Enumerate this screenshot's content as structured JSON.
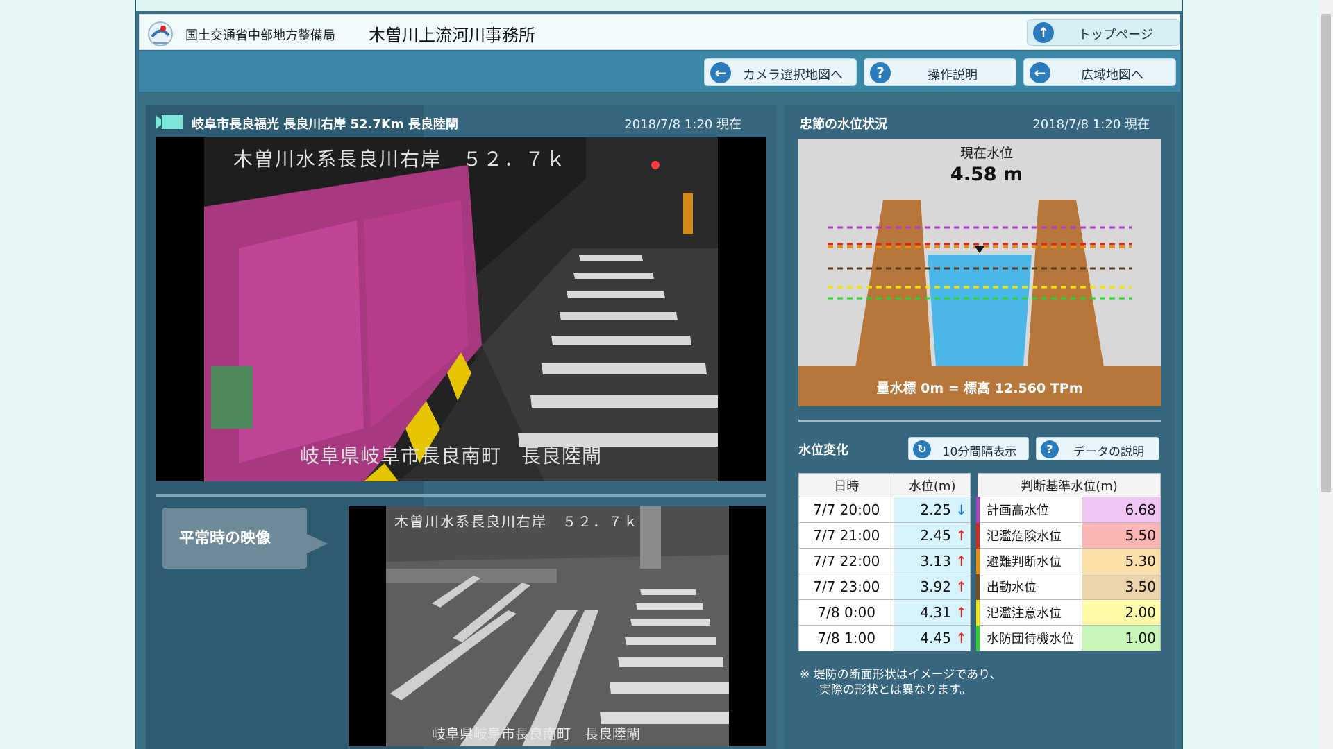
{
  "header": {
    "ministry": "国土交通省中部地方整備局",
    "office": "木曽川上流河川事務所",
    "top_button": "トップページ"
  },
  "nav": {
    "camera_map": "カメラ選択地図へ",
    "help": "操作説明",
    "wide_map": "広域地図へ"
  },
  "camera": {
    "title": "岐阜市長良福光 長良川右岸 52.7Km 長良陸閘",
    "time": "2018/7/8 1:20 現在",
    "live_overlay_top": "木曽川水系長良川右岸　５２．７ｋ",
    "live_overlay_bottom": "岐阜県岐阜市長良南町　長良陸閘",
    "normal_label": "平常時の映像",
    "normal_overlay_top": "木曽川水系長良川右岸　５２．７ｋ",
    "normal_overlay_bottom": "岐阜県岐阜市長良南町　長良陸閘"
  },
  "water": {
    "title": "忠節の水位状況",
    "time": "2018/7/8 1:20 現在",
    "current_label": "現在水位",
    "current_value": "4.58 m",
    "current_level": 4.58,
    "datum_label": "量水標 0m = 標高 12.560 TPm",
    "change_label": "水位変化",
    "btn_interval": "10分間隔表示",
    "btn_data": "データの説明",
    "history_headers": [
      "日時",
      "水位(m)"
    ],
    "history": [
      {
        "date": "7/7 20:00",
        "value": "2.25",
        "trend": "↓",
        "dir": "down"
      },
      {
        "date": "7/7 21:00",
        "value": "2.45",
        "trend": "↑",
        "dir": "up"
      },
      {
        "date": "7/7 22:00",
        "value": "3.13",
        "trend": "↑",
        "dir": "up"
      },
      {
        "date": "7/7 23:00",
        "value": "3.92",
        "trend": "↑",
        "dir": "up"
      },
      {
        "date": "7/8 0:00",
        "value": "4.31",
        "trend": "↑",
        "dir": "up"
      },
      {
        "date": "7/8 1:00",
        "value": "4.45",
        "trend": "↑",
        "dir": "up"
      }
    ],
    "criteria_header": "判断基準水位(m)",
    "criteria": [
      {
        "name": "計画高水位",
        "value": "6.68",
        "color": "#b03cc8",
        "bg": "#f1c6f5"
      },
      {
        "name": "氾濫危険水位",
        "value": "5.50",
        "color": "#e2231a",
        "bg": "#fbb4b4"
      },
      {
        "name": "避難判断水位",
        "value": "5.30",
        "color": "#f08c00",
        "bg": "#fde0a8"
      },
      {
        "name": "出動水位",
        "value": "3.50",
        "color": "#7a4a1e",
        "bg": "#ecd5aa"
      },
      {
        "name": "氾濫注意水位",
        "value": "2.00",
        "color": "#f2e600",
        "bg": "#fdfaa8"
      },
      {
        "name": "水防団待機水位",
        "value": "1.00",
        "color": "#2ed12e",
        "bg": "#c8f5b8"
      }
    ],
    "note_line1": "※ 堤防の断面形状はイメージであり、",
    "note_line2": "実際の形状とは異なります。"
  }
}
